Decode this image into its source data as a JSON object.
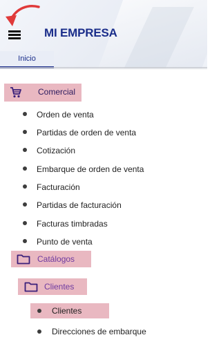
{
  "header": {
    "brand": "MI EMPRESA",
    "menu_icon": "hamburger-icon",
    "annotation_icon": "curved-arrow-icon",
    "accent_color": "#1a2d8a",
    "highlight_color": "#e9b8c1"
  },
  "tabs": [
    {
      "label": "Inicio",
      "active": true
    }
  ],
  "menu": {
    "section": {
      "label": "Comercial",
      "icon": "cart-icon"
    },
    "items": [
      "Orden de venta",
      "Partidas de orden de venta",
      "Cotización",
      "Embarque de orden de venta",
      "Facturación",
      "Partidas de facturación",
      "Facturas timbradas",
      "Punto de venta"
    ],
    "catalogos": {
      "label": "Catálogos",
      "icon": "folder-icon"
    },
    "clientes": {
      "label": "Clientes",
      "icon": "folder-icon"
    },
    "clientes_items": [
      "Clientes",
      "Direcciones de embarque"
    ]
  }
}
